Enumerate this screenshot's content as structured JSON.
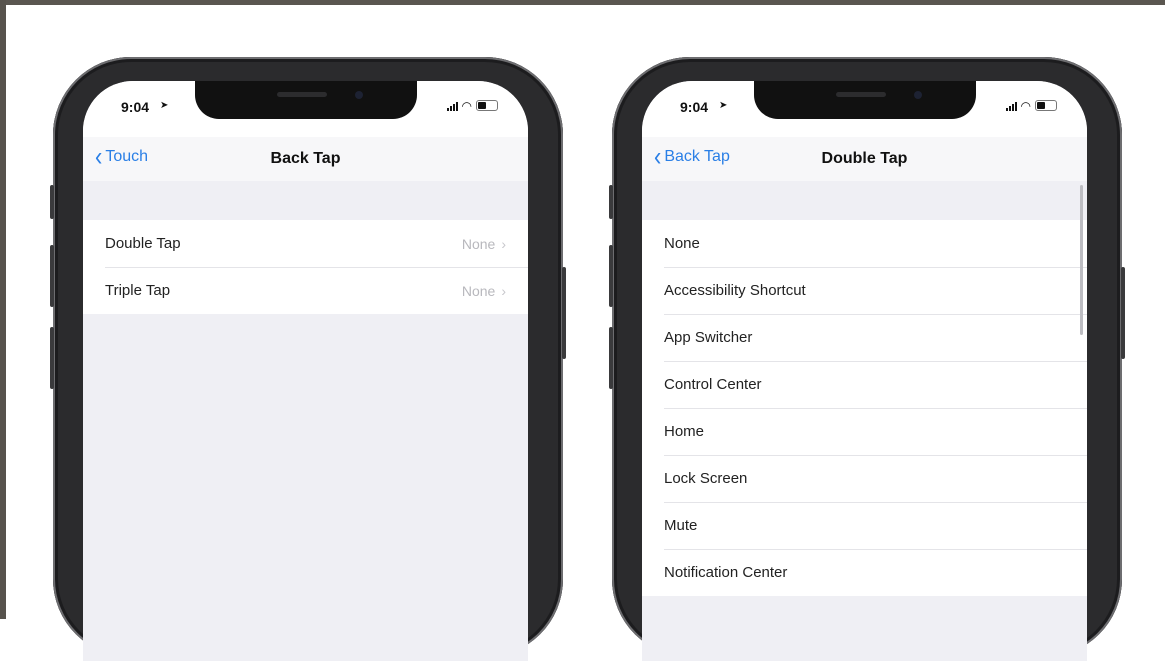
{
  "left_phone": {
    "status": {
      "time": "9:04",
      "location_icon": "location-arrow-icon"
    },
    "nav": {
      "back_label": "Touch",
      "title": "Back Tap"
    },
    "rows": [
      {
        "label": "Double Tap",
        "value": "None"
      },
      {
        "label": "Triple Tap",
        "value": "None"
      }
    ]
  },
  "right_phone": {
    "status": {
      "time": "9:04",
      "location_icon": "location-arrow-icon"
    },
    "nav": {
      "back_label": "Back Tap",
      "title": "Double Tap"
    },
    "options": [
      "None",
      "Accessibility Shortcut",
      "App Switcher",
      "Control Center",
      "Home",
      "Lock Screen",
      "Mute",
      "Notification Center"
    ]
  },
  "colors": {
    "accent": "#2a7fe6",
    "background": "#efeff4"
  }
}
